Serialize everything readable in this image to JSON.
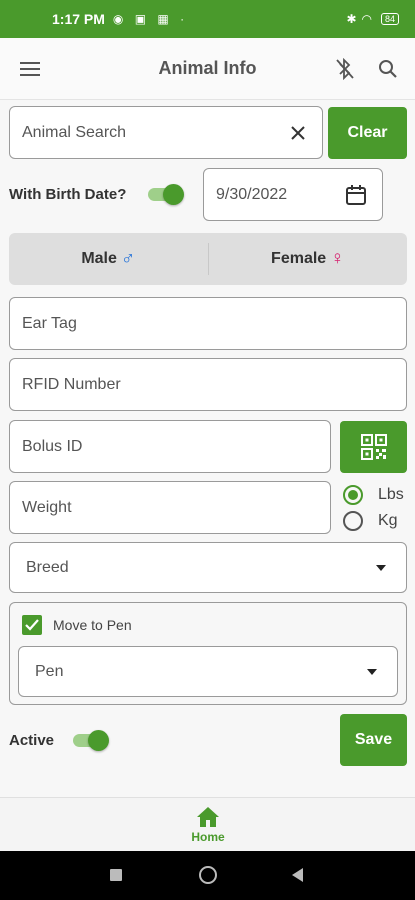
{
  "status_bar": {
    "time": "1:17 PM",
    "battery": "84"
  },
  "app_bar": {
    "title": "Animal Info",
    "menu_icon": "hamburger-menu-icon",
    "bluetooth_icon": "bluetooth-disabled-icon",
    "search_icon": "search-icon"
  },
  "search": {
    "placeholder": "Animal Search",
    "value": "",
    "clear_label": "Clear"
  },
  "birth_date": {
    "label": "With Birth Date?",
    "enabled": true,
    "date": "9/30/2022"
  },
  "gender": {
    "male_label": "Male",
    "male_symbol": "♂",
    "male_color": "#1e6fd9",
    "female_label": "Female",
    "female_symbol": "♀",
    "female_color": "#d6206e"
  },
  "fields": {
    "ear_tag": "Ear Tag",
    "rfid": "RFID Number",
    "bolus": "Bolus ID",
    "weight": "Weight"
  },
  "weight_units": [
    {
      "label": "Lbs",
      "selected": true
    },
    {
      "label": "Kg",
      "selected": false
    }
  ],
  "breed": {
    "selected": "Breed"
  },
  "move_to_pen": {
    "label": "Move to Pen",
    "checked": true,
    "pen_selected": "Pen"
  },
  "active": {
    "label": "Active",
    "enabled": true
  },
  "save_label": "Save",
  "bottom_nav": {
    "home_label": "Home"
  },
  "colors": {
    "accent": "#4a9a2c"
  }
}
